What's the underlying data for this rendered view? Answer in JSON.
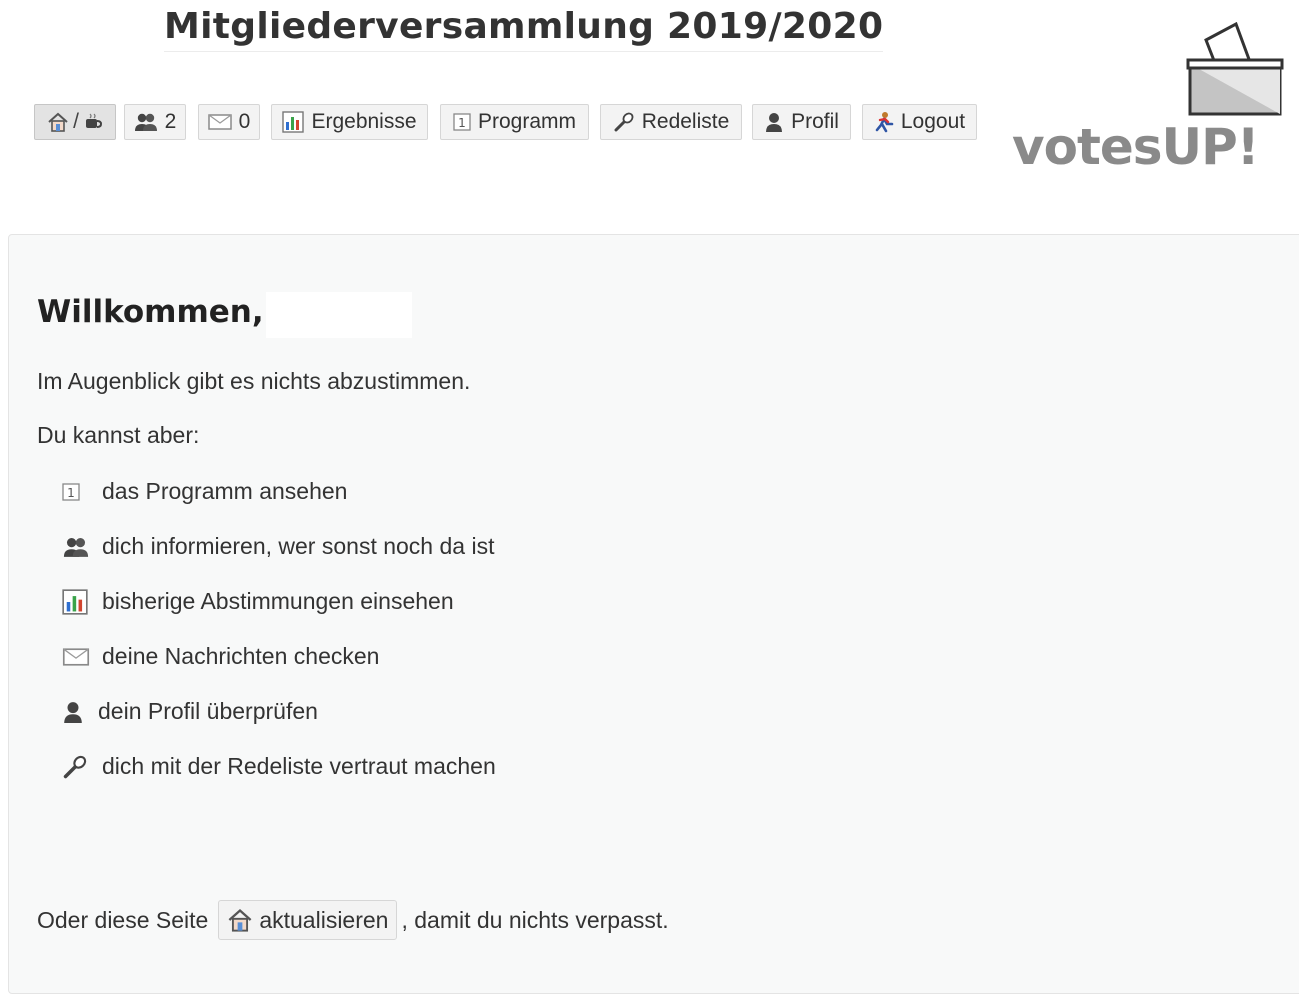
{
  "page": {
    "title": "Mitgliederversammlung 2019/2020"
  },
  "nav": {
    "home": {
      "separator": "/",
      "icons": [
        "house-icon",
        "cup-icon"
      ]
    },
    "participants": {
      "count": "2",
      "icon": "people-icon"
    },
    "messages": {
      "count": "0",
      "icon": "envelope-icon"
    },
    "results": {
      "label": "Ergebnisse",
      "icon": "bar-chart-icon"
    },
    "program": {
      "label": "Programm",
      "icon": "numbered-list-icon"
    },
    "speakers": {
      "label": "Redeliste",
      "icon": "microphone-icon"
    },
    "profile": {
      "label": "Profil",
      "icon": "person-icon"
    },
    "logout": {
      "label": "Logout",
      "icon": "running-person-icon"
    }
  },
  "logo": {
    "text": "votesUP!",
    "icon": "ballot-box-icon"
  },
  "main": {
    "welcome": "Willkommen,",
    "intro": "Im Augenblick gibt es nichts abzustimmen.",
    "can_do": "Du kannst aber:",
    "items": [
      {
        "label": "das Programm ansehen",
        "icon": "numbered-list-icon"
      },
      {
        "label": "dich informieren, wer sonst noch da ist",
        "icon": "people-icon"
      },
      {
        "label": "bisherige Abstimmungen einsehen",
        "icon": "bar-chart-icon"
      },
      {
        "label": "deine Nachrichten checken",
        "icon": "envelope-icon"
      },
      {
        "label": "dein Profil überprüfen",
        "icon": "person-icon"
      },
      {
        "label": "dich mit der Redeliste vertraut machen",
        "icon": "microphone-icon"
      }
    ],
    "refresh_prefix": "Oder diese Seite",
    "refresh_button": "aktualisieren",
    "refresh_suffix": ", damit du nichts verpasst."
  },
  "colors": {
    "button_bg": "#f3f3f3",
    "button_border": "#d6d6d6",
    "panel_bg": "#f8f9f9",
    "logo_gray": "#8a8a8a"
  }
}
